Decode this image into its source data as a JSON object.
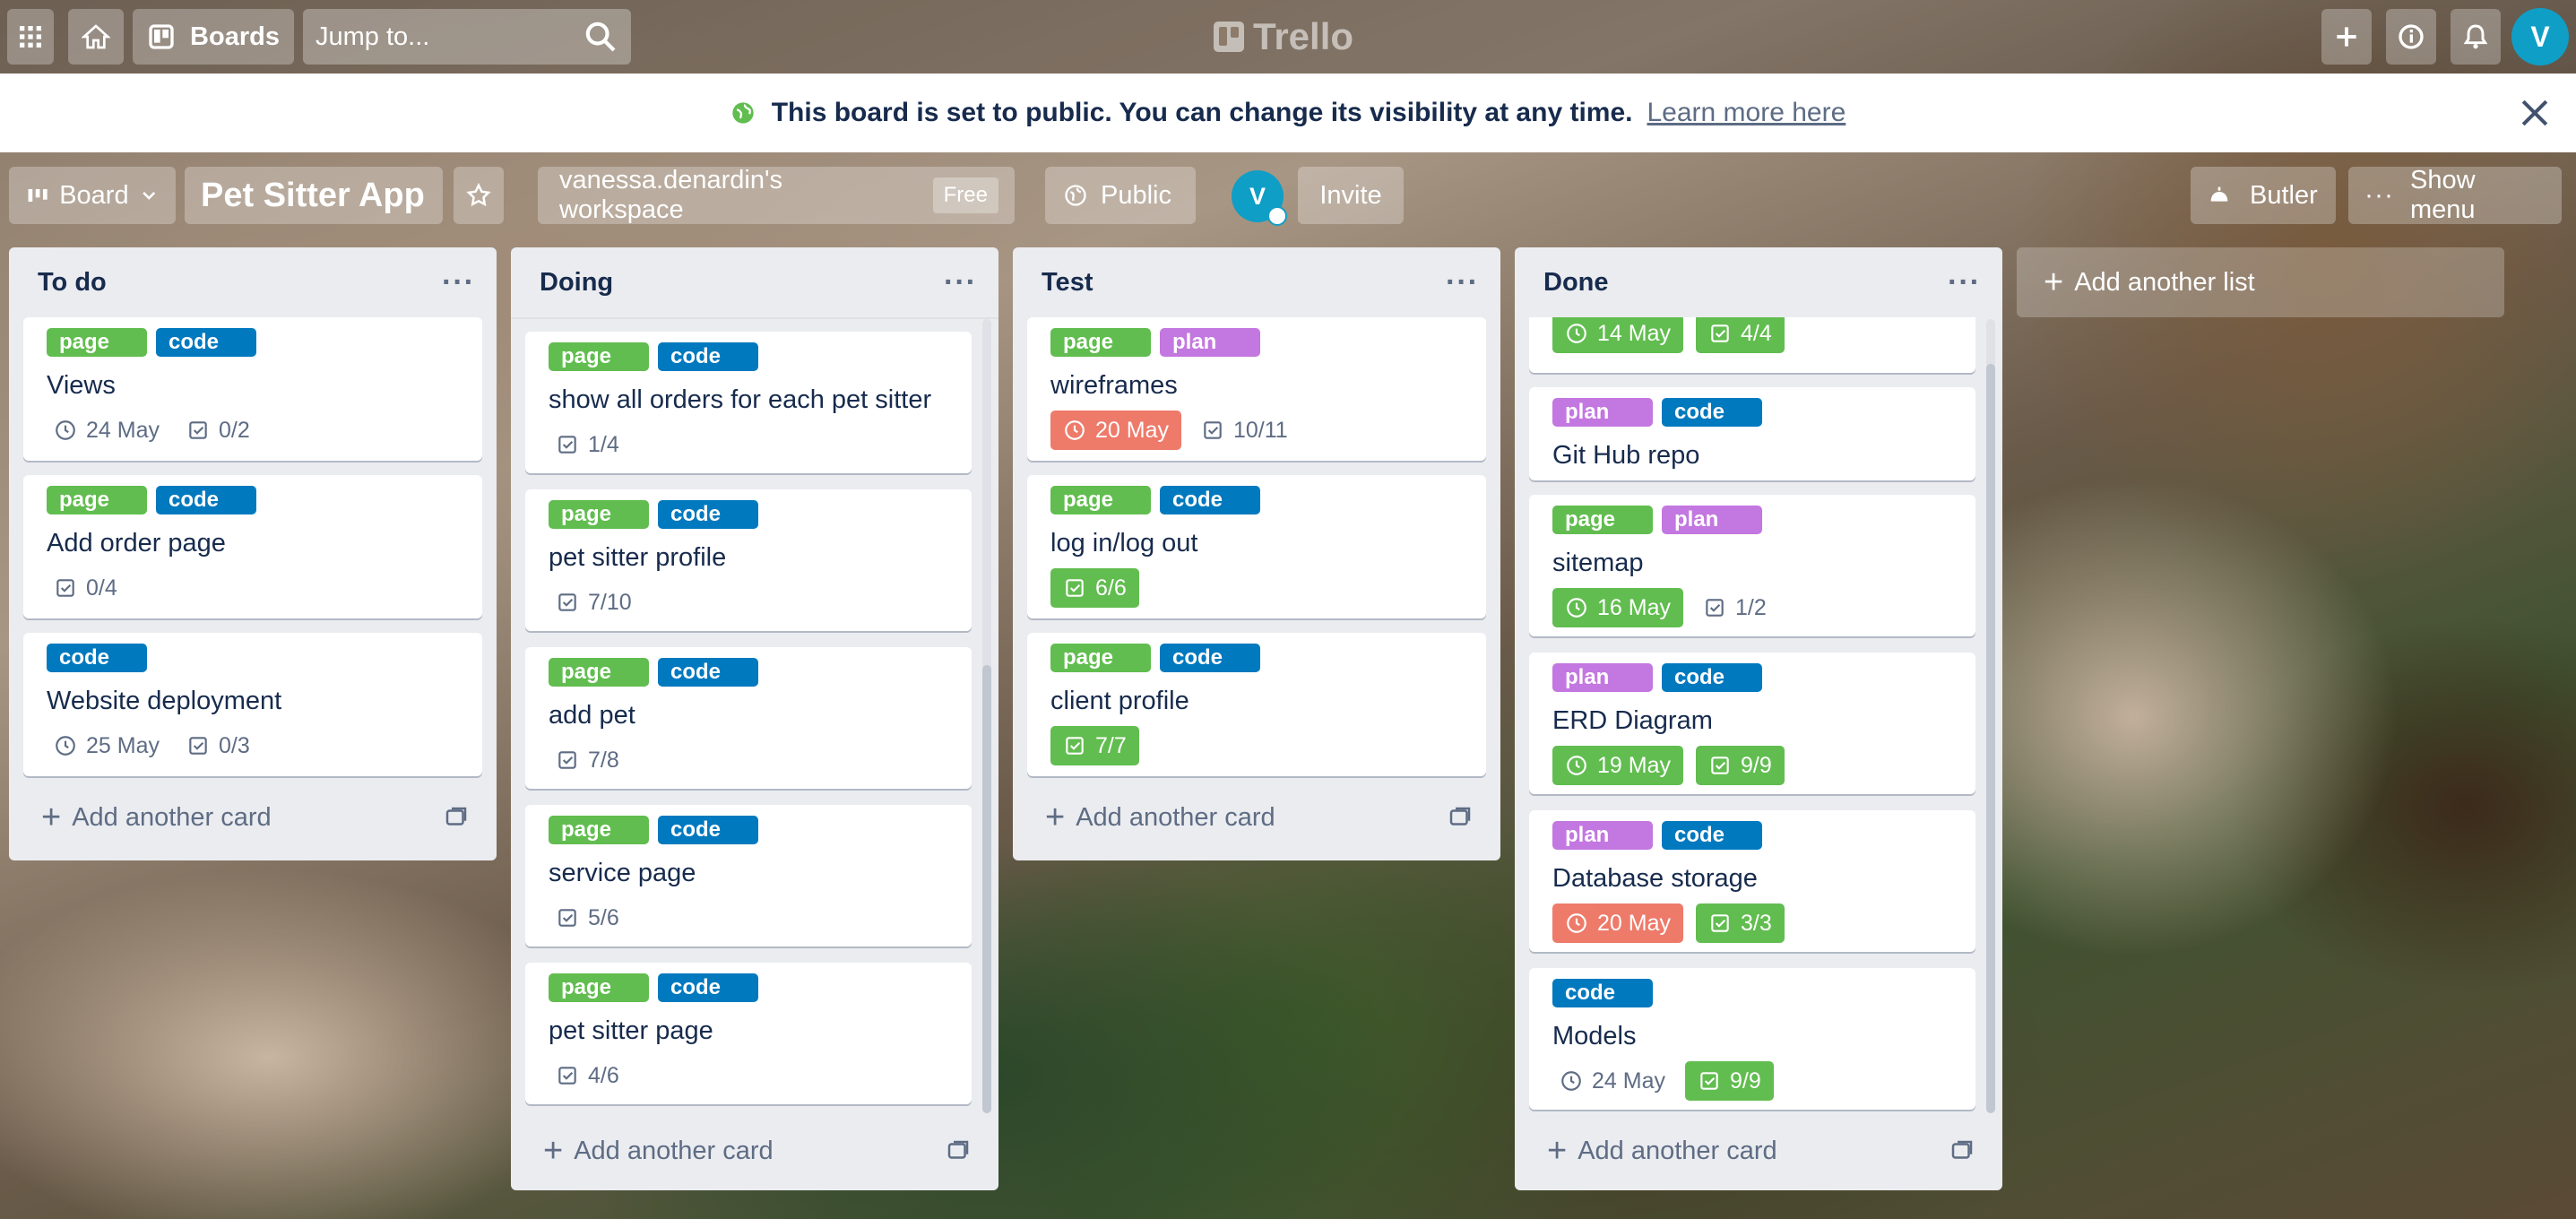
{
  "nav": {
    "boards_label": "Boards",
    "search_placeholder": "Jump to...",
    "logo_text": "Trello",
    "avatar_initial": "V"
  },
  "banner": {
    "message": "This board is set to public. You can change its visibility at any time.",
    "link": "Learn more here"
  },
  "board_header": {
    "view_label": "Board",
    "title": "Pet Sitter App",
    "workspace": "vanessa.denardin's workspace",
    "workspace_plan": "Free",
    "visibility": "Public",
    "member_initial": "V",
    "invite_label": "Invite",
    "butler_label": "Butler",
    "show_menu_label": "Show menu"
  },
  "add_card_label": "Add another card",
  "add_list_label": "Add another list",
  "lists": [
    {
      "title": "To do",
      "cards": [
        {
          "labels": [
            "page",
            "code"
          ],
          "title": "Views",
          "due": "24 May",
          "checklist": "0/2"
        },
        {
          "labels": [
            "page",
            "code"
          ],
          "title": "Add order page",
          "checklist": "0/4"
        },
        {
          "labels": [
            "code"
          ],
          "title": "Website deployment",
          "due": "25 May",
          "checklist": "0/3"
        }
      ]
    },
    {
      "title": "Doing",
      "cards": [
        {
          "labels": [
            "page",
            "code"
          ],
          "title": "show all orders for each pet sitter",
          "checklist": "1/4"
        },
        {
          "labels": [
            "page",
            "code"
          ],
          "title": "pet sitter profile",
          "checklist": "7/10"
        },
        {
          "labels": [
            "page",
            "code"
          ],
          "title": "add pet",
          "checklist": "7/8"
        },
        {
          "labels": [
            "page",
            "code"
          ],
          "title": "service page",
          "checklist": "5/6"
        },
        {
          "labels": [
            "page",
            "code"
          ],
          "title": "pet sitter page",
          "checklist": "4/6"
        }
      ]
    },
    {
      "title": "Test",
      "cards": [
        {
          "labels": [
            "page",
            "plan"
          ],
          "title": "wireframes",
          "due": "20 May",
          "due_status": "overdue",
          "checklist": "10/11"
        },
        {
          "labels": [
            "page",
            "code"
          ],
          "title": "log in/log out",
          "checklist": "6/6",
          "checklist_status": "complete"
        },
        {
          "labels": [
            "page",
            "code"
          ],
          "title": "client profile",
          "checklist": "7/7",
          "checklist_status": "complete"
        }
      ]
    },
    {
      "title": "Done",
      "cards": [
        {
          "labels": [],
          "title": "",
          "due": "14 May",
          "due_status": "complete",
          "checklist": "4/4",
          "checklist_status": "complete"
        },
        {
          "labels": [
            "plan",
            "code"
          ],
          "title": "Git Hub repo"
        },
        {
          "labels": [
            "page",
            "plan"
          ],
          "title": "sitemap",
          "due": "16 May",
          "due_status": "complete",
          "checklist": "1/2"
        },
        {
          "labels": [
            "plan",
            "code"
          ],
          "title": "ERD Diagram",
          "due": "19 May",
          "due_status": "complete",
          "checklist": "9/9",
          "checklist_status": "complete"
        },
        {
          "labels": [
            "plan",
            "code"
          ],
          "title": "Database storage",
          "due": "20 May",
          "due_status": "overdue",
          "checklist": "3/3",
          "checklist_status": "complete"
        },
        {
          "labels": [
            "code"
          ],
          "title": "Models",
          "due": "24 May",
          "checklist": "9/9",
          "checklist_status": "complete"
        }
      ]
    }
  ],
  "colors": {
    "page": "#61bd4f",
    "code": "#0079bf",
    "plan": "#c377e0",
    "overdue": "#eb5a46",
    "complete": "#61bd4f"
  }
}
